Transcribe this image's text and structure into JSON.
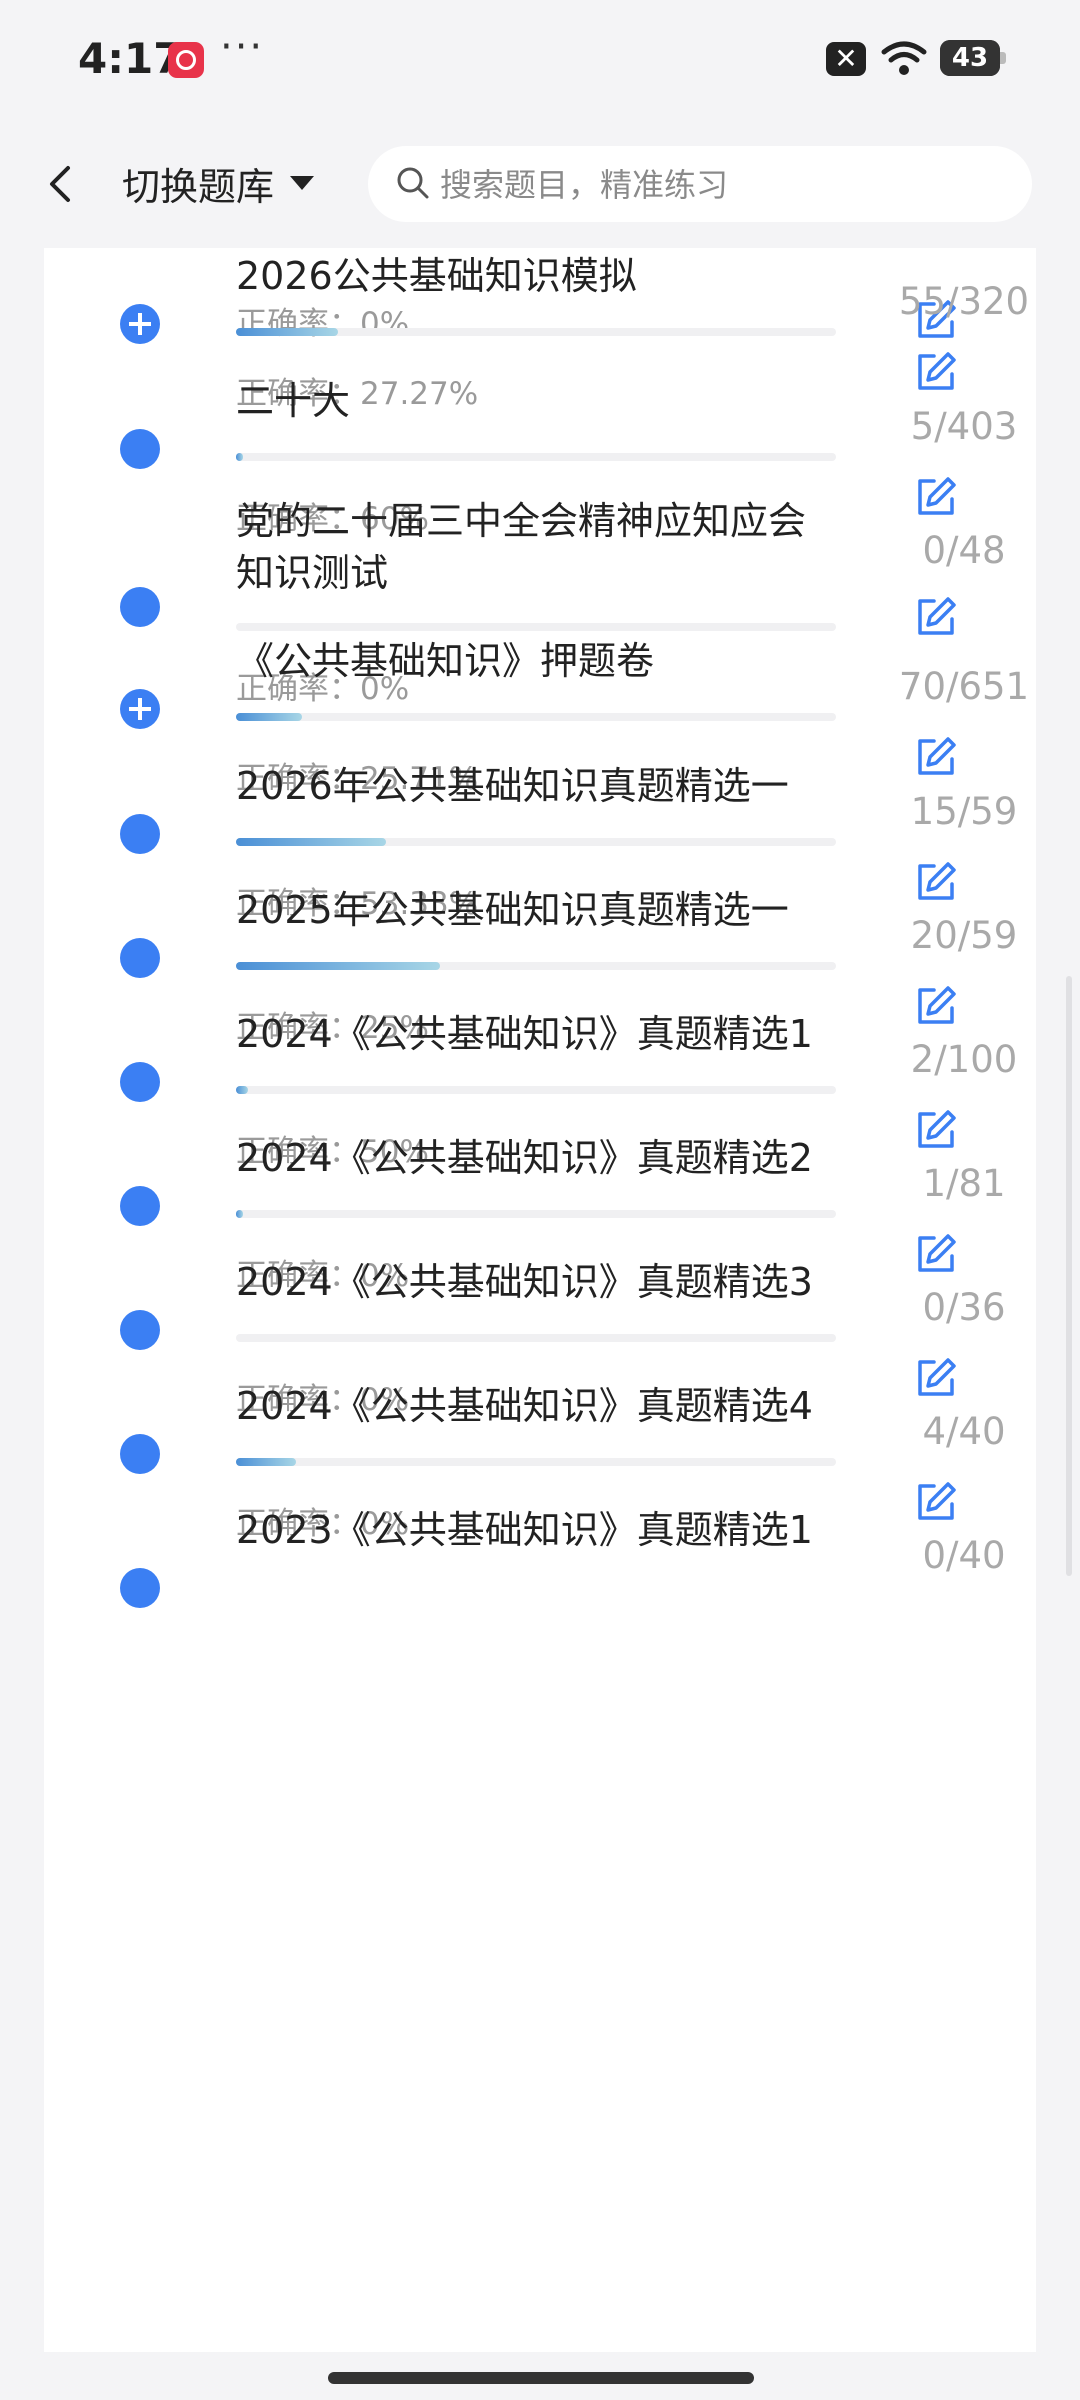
{
  "status": {
    "time": "4:17",
    "battery": "43",
    "icons": [
      "app-badge-icon",
      "more-dots-icon",
      "notification-close-icon",
      "wifi-icon",
      "battery-icon"
    ]
  },
  "header": {
    "title": "切换题库",
    "search_placeholder": "搜索题目，精准练习"
  },
  "colors": {
    "accent": "#3b7ff3",
    "bar_start": "#4a8fd6",
    "bar_end": "#a8d6e6"
  },
  "items": [
    {
      "title": "",
      "accuracy": "正确率：0%",
      "count": "",
      "progress": 0,
      "icon": ""
    },
    {
      "title": "2026公共基础知识模拟",
      "accuracy": "正确率：27.27%",
      "count": "55/320",
      "progress": 0.17,
      "icon": "plus"
    },
    {
      "title": "二十大",
      "accuracy": "正确率：60%",
      "count": "5/403",
      "progress": 0.012,
      "icon": "dot"
    },
    {
      "title": "党的二十届三中全会精神应知应会知识测试",
      "accuracy": "正确率：0%",
      "count": "0/48",
      "progress": 0,
      "icon": "dot"
    },
    {
      "title": "《公共基础知识》押题卷",
      "accuracy": "正确率：25.71%",
      "count": "70/651",
      "progress": 0.11,
      "icon": "plus"
    },
    {
      "title": "2026年公共基础知识真题精选一",
      "accuracy": "正确率：53.33%",
      "count": "15/59",
      "progress": 0.25,
      "icon": "dot"
    },
    {
      "title": "2025年公共基础知识真题精选一",
      "accuracy": "正确率：25%",
      "count": "20/59",
      "progress": 0.34,
      "icon": "dot"
    },
    {
      "title": "2024《公共基础知识》真题精选1",
      "accuracy": "正确率：50%",
      "count": "2/100",
      "progress": 0.02,
      "icon": "dot"
    },
    {
      "title": "2024《公共基础知识》真题精选2",
      "accuracy": "正确率：0%",
      "count": "1/81",
      "progress": 0.012,
      "icon": "dot"
    },
    {
      "title": "2024《公共基础知识》真题精选3",
      "accuracy": "正确率：0%",
      "count": "0/36",
      "progress": 0,
      "icon": "dot"
    },
    {
      "title": "2024《公共基础知识》真题精选4",
      "accuracy": "正确率：0%",
      "count": "4/40",
      "progress": 0.1,
      "icon": "dot"
    },
    {
      "title": "2023《公共基础知识》真题精选1",
      "accuracy": "",
      "count": "0/40",
      "progress": 0,
      "icon": "dot"
    }
  ]
}
